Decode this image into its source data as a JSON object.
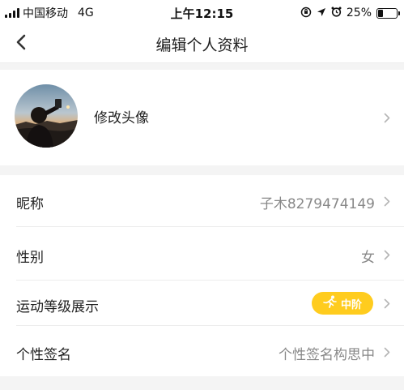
{
  "status_bar": {
    "carrier": "中国移动",
    "network": "4G",
    "time": "上午12:15",
    "battery_percent": "25%",
    "battery_level": 0.25,
    "icons": [
      "rotation-lock-icon",
      "location-arrow-icon",
      "alarm-icon",
      "battery-icon",
      "signal-bars-icon"
    ]
  },
  "nav": {
    "title": "编辑个人资料",
    "back_icon": "chevron-left-icon"
  },
  "avatar_section": {
    "label": "修改头像",
    "chevron_icon": "chevron-right-icon"
  },
  "profile_items": [
    {
      "label": "昵称",
      "value": "子木8279474149"
    },
    {
      "label": "性别",
      "value": "女"
    },
    {
      "label": "运动等级展示",
      "badge": {
        "text": "中阶",
        "icon": "runner-icon",
        "color": "#ffcc1e"
      }
    },
    {
      "label": "个性签名",
      "value": "个性签名构思中"
    }
  ],
  "colors": {
    "accent": "#ffcc1e",
    "background": "#f4f4f4",
    "value_text": "#888888"
  }
}
